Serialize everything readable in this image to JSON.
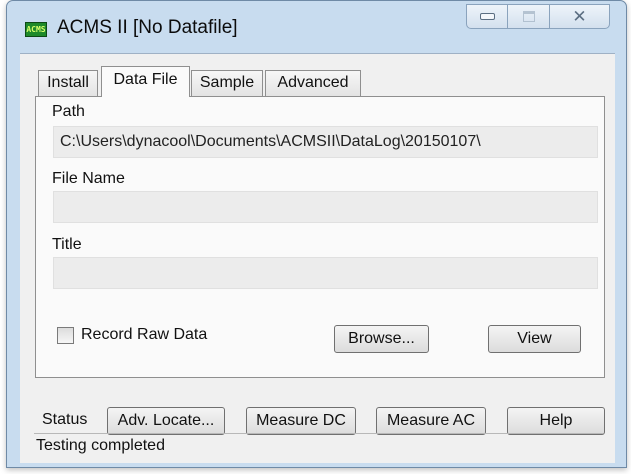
{
  "window": {
    "title": "ACMS II [No Datafile]",
    "icon": "acms-app-icon",
    "icon_text": "ACMS",
    "controls": {
      "minimize": "minimize-icon",
      "maximize": "maximize-icon",
      "close": "close-icon"
    }
  },
  "tabs": [
    {
      "label": "Install",
      "active": false
    },
    {
      "label": "Data File",
      "active": true
    },
    {
      "label": "Sample",
      "active": false
    },
    {
      "label": "Advanced",
      "active": false
    }
  ],
  "data_file": {
    "path_label": "Path",
    "path_value": "C:\\Users\\dynacool\\Documents\\ACMSII\\DataLog\\20150107\\",
    "file_name_label": "File Name",
    "file_name_value": "",
    "title_label": "Title",
    "title_value": "",
    "record_raw_label": "Record Raw Data",
    "record_raw_checked": false,
    "browse_label": "Browse...",
    "view_label": "View"
  },
  "bottom": {
    "status_label": "Status",
    "buttons": {
      "adv_locate": "Adv. Locate...",
      "measure_dc": "Measure DC",
      "measure_ac": "Measure AC",
      "help": "Help"
    },
    "status_text": "Testing completed"
  },
  "colors": {
    "window_frame": "#c8dcef",
    "client_bg": "#f0f0f0",
    "field_bg": "#ececec",
    "app_icon": "#1e8a2a"
  }
}
